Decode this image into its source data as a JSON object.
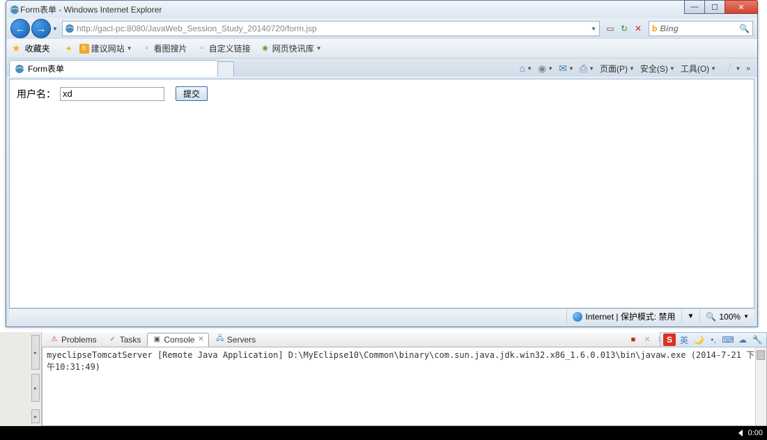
{
  "window": {
    "title": "Form表单 - Windows Internet Explorer"
  },
  "nav": {
    "url": "http://gacl-pc:8080/JavaWeb_Session_Study_20140720/form.jsp",
    "search_engine": "Bing"
  },
  "favorites": {
    "label": "收藏夹",
    "items": [
      "建议网站",
      "看图搜片",
      "自定义链接",
      "网页快讯库"
    ]
  },
  "tab": {
    "title": "Form表单"
  },
  "toolbar": {
    "page": "页面(P)",
    "safety": "安全(S)",
    "tools": "工具(O)"
  },
  "form": {
    "label": "用户名：",
    "value": "xd",
    "submit": "提交"
  },
  "status": {
    "zone": "Internet | 保护模式: 禁用",
    "zoom": "100%"
  },
  "eclipse": {
    "tabs": [
      "Problems",
      "Tasks",
      "Console",
      "Servers"
    ],
    "active_tab": "Console",
    "console_line": "myeclipseTomcatServer [Remote Java Application] D:\\MyEclipse10\\Common\\binary\\com.sun.java.jdk.win32.x86_1.6.0.013\\bin\\javaw.exe (2014-7-21 下午10:31:49)"
  },
  "ime": {
    "lang": "英"
  },
  "taskbar": {
    "time": "0:00"
  }
}
